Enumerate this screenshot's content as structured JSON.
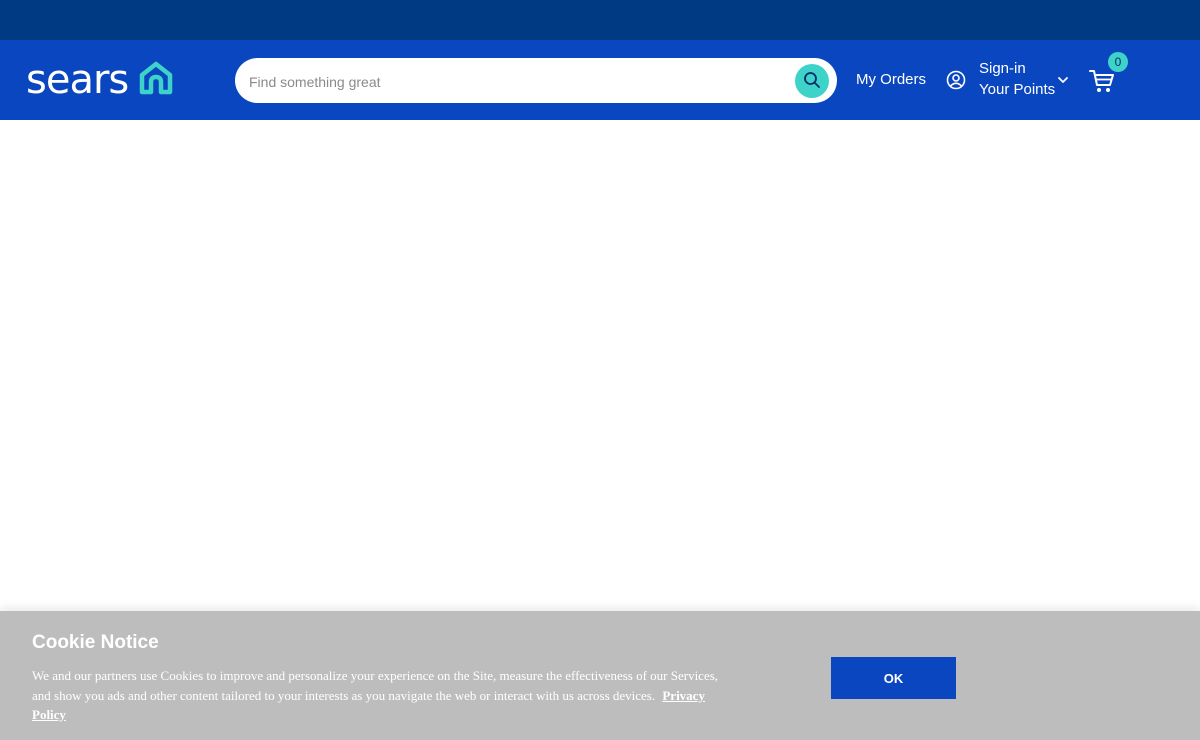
{
  "colors": {
    "topbar": "#003a82",
    "header": "#0a46bf",
    "accent": "#3ed3c9",
    "cookie_banner": "#bdbdbd"
  },
  "header": {
    "logo_text": "sears",
    "logo_icon": "home-icon",
    "search": {
      "placeholder": "Find something great",
      "value": "",
      "button_icon": "search-icon"
    },
    "my_orders_label": "My Orders",
    "account": {
      "icon": "user-circle-icon",
      "line1": "Sign-in",
      "line2": "Your Points",
      "chevron_icon": "chevron-down-icon"
    },
    "cart": {
      "icon": "cart-icon",
      "count": "0"
    }
  },
  "cookie_notice": {
    "title": "Cookie Notice",
    "text": "We and our partners use Cookies to improve and personalize your experience on the Site, measure the effectiveness of our Services, and show you ads and other content tailored to your interests as you navigate the web or interact with us across devices.",
    "link_label": "Privacy Policy",
    "ok_label": "OK"
  }
}
